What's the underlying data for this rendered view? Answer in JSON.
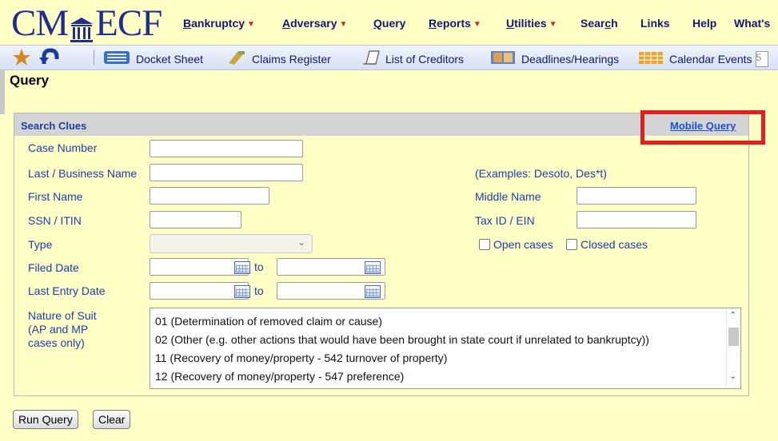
{
  "logo": {
    "left": "CM",
    "right": "ECF"
  },
  "menu": [
    {
      "label": "Bankruptcy",
      "underline": "B",
      "rest": "ankruptcy",
      "caret": true
    },
    {
      "label": "Adversary",
      "underline": "A",
      "rest": "dversary",
      "caret": true
    },
    {
      "label": "Query",
      "underline": "Q",
      "rest": "uery",
      "caret": false
    },
    {
      "label": "Reports",
      "underline": "R",
      "rest": "eports",
      "caret": true
    },
    {
      "label": "Utilities",
      "underline": "U",
      "rest": "tilities",
      "caret": true
    },
    {
      "label": "Search",
      "pre": "Sear",
      "underline": "c",
      "rest": "h",
      "caret": false
    },
    {
      "label": "Links",
      "caret": false
    },
    {
      "label": "Help",
      "caret": false
    },
    {
      "label": "What's",
      "caret": false
    }
  ],
  "toolbar": {
    "docket_sheet": "Docket Sheet",
    "claims_register": "Claims Register",
    "list_of_creditors": "List of Creditors",
    "deadlines_hearings": "Deadlines/Hearings",
    "calendar_events": "Calendar Events",
    "calendar_input_value": "5"
  },
  "page_title": "Query",
  "search_clues": {
    "title": "Search Clues",
    "mobile_query": "Mobile Query",
    "labels": {
      "case_number": "Case Number",
      "last_business_name": "Last / Business Name",
      "first_name": "First Name",
      "ssn_itin": "SSN / ITIN",
      "type": "Type",
      "filed_date": "Filed Date",
      "last_entry_date": "Last Entry Date",
      "nature_of_suit_1": "Nature of Suit",
      "nature_of_suit_2": "(AP and MP",
      "nature_of_suit_3": "cases only)",
      "examples": "(Examples: Desoto, Des*t)",
      "middle_name": "Middle Name",
      "tax_id_ein": "Tax ID / EIN",
      "open_cases": "Open cases",
      "closed_cases": "Closed cases",
      "to": "to"
    },
    "values": {
      "case_number": "",
      "last_business_name": "",
      "first_name": "",
      "ssn_itin": "",
      "type": "",
      "middle_name": "",
      "tax_id_ein": "",
      "filed_from": "",
      "filed_to": "",
      "last_entry_from": "",
      "last_entry_to": ""
    },
    "open_cases_checked": false,
    "closed_cases_checked": false,
    "nature_of_suit_options": [
      "01 (Determination of removed claim or cause)",
      "02 (Other (e.g. other actions that would have been brought in state court if unrelated to bankruptcy))",
      "11 (Recovery of money/property - 542 turnover of property)",
      "12 (Recovery of money/property - 547 preference)"
    ]
  },
  "buttons": {
    "run_query": "Run Query",
    "clear": "Clear"
  },
  "colors": {
    "background": "#ffffc6",
    "link": "#1a3fa6",
    "highlight_box": "#e0201e",
    "panel_header": "#d4d4d4"
  }
}
